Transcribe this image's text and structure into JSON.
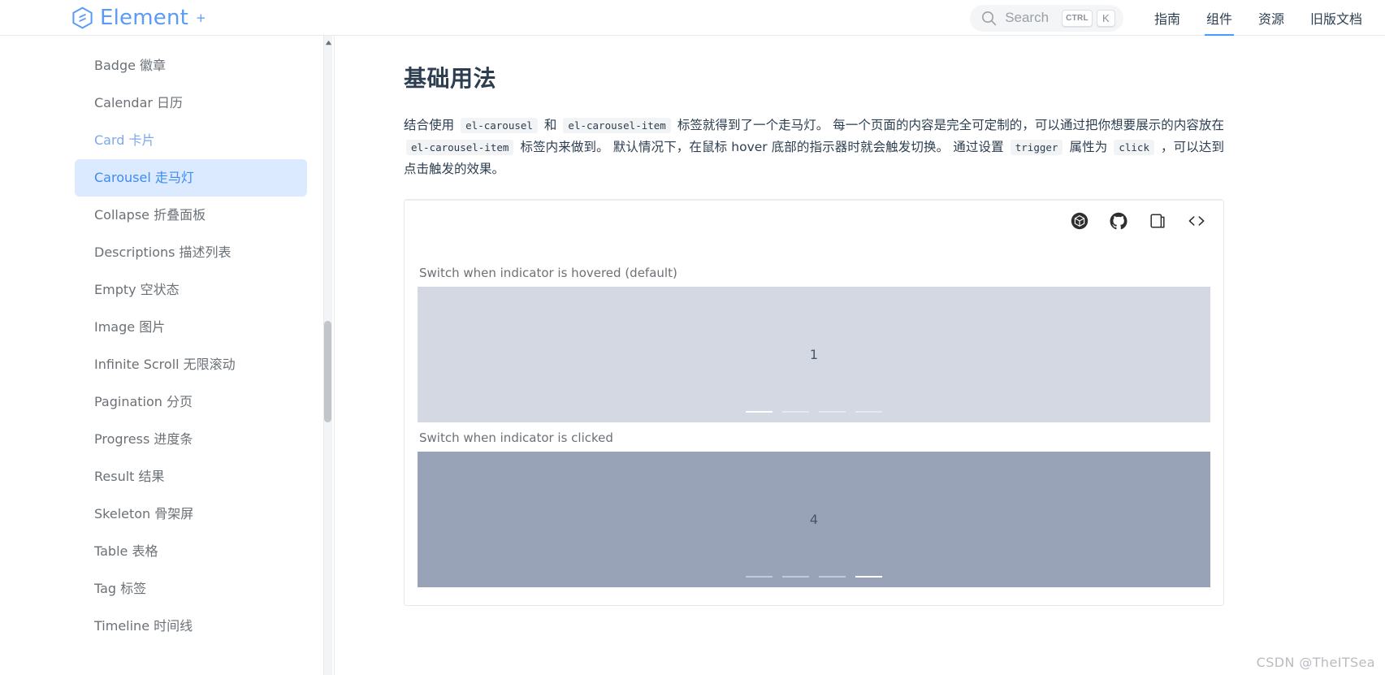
{
  "header": {
    "brand": {
      "name": "Element",
      "superscript": "+",
      "icon": "element-logo-icon",
      "color": "#5a9bf4"
    },
    "search": {
      "label": "Search",
      "icon": "search-icon",
      "keys": [
        "CTRL",
        "K"
      ]
    },
    "nav": [
      {
        "label": "指南",
        "active": false
      },
      {
        "label": "组件",
        "active": true
      },
      {
        "label": "资源",
        "active": false
      },
      {
        "label": "旧版文档",
        "active": false
      }
    ]
  },
  "sidebar": {
    "items": [
      {
        "label": "Badge 徽章",
        "state": "normal"
      },
      {
        "label": "Calendar 日历",
        "state": "normal"
      },
      {
        "label": "Card 卡片",
        "state": "visited"
      },
      {
        "label": "Carousel 走马灯",
        "state": "active"
      },
      {
        "label": "Collapse 折叠面板",
        "state": "normal"
      },
      {
        "label": "Descriptions 描述列表",
        "state": "normal"
      },
      {
        "label": "Empty 空状态",
        "state": "normal"
      },
      {
        "label": "Image 图片",
        "state": "normal"
      },
      {
        "label": "Infinite Scroll 无限滚动",
        "state": "normal"
      },
      {
        "label": "Pagination 分页",
        "state": "normal"
      },
      {
        "label": "Progress 进度条",
        "state": "normal"
      },
      {
        "label": "Result 结果",
        "state": "normal"
      },
      {
        "label": "Skeleton 骨架屏",
        "state": "normal"
      },
      {
        "label": "Table 表格",
        "state": "normal"
      },
      {
        "label": "Tag 标签",
        "state": "normal"
      },
      {
        "label": "Timeline 时间线",
        "state": "normal"
      }
    ],
    "active_color": "#3d8bf2",
    "active_background": "#dbeafe"
  },
  "main": {
    "title": "基础用法",
    "description": {
      "part1": "结合使用",
      "code1": "el-carousel",
      "part2": "和",
      "code2": "el-carousel-item",
      "part3": "标签就得到了一个走马灯。 每一个页面的内容是完全可定制的，可以通过把你想要展示的内容放在",
      "code3": "el-carousel-item",
      "part4": "标签内来做到。 默认情况下，在鼠标 hover 底部的指示器时就会触发切换。 通过设置",
      "code4": "trigger",
      "part5": "属性为",
      "code5": "click",
      "part6": "，可以达到点击触发的效果。"
    },
    "demo": {
      "toolbar": [
        {
          "icon": "codesandbox-icon",
          "label": "在 CodeSandbox 中打开"
        },
        {
          "icon": "github-icon",
          "label": "在 GitHub 中查看"
        },
        {
          "icon": "copy-icon",
          "label": "复制代码"
        },
        {
          "icon": "code-icon",
          "label": "查看源代码"
        }
      ],
      "carousels": [
        {
          "caption": "Switch when indicator is hovered (default)",
          "slide_label": "1",
          "background": "#d3d8e2",
          "indicator_count": 4,
          "active_index": 0,
          "trigger": "hover"
        },
        {
          "caption": "Switch when indicator is clicked",
          "slide_label": "4",
          "background": "#98a3b8",
          "indicator_count": 4,
          "active_index": 3,
          "trigger": "click"
        }
      ]
    }
  },
  "watermark": "CSDN @TheITSea"
}
